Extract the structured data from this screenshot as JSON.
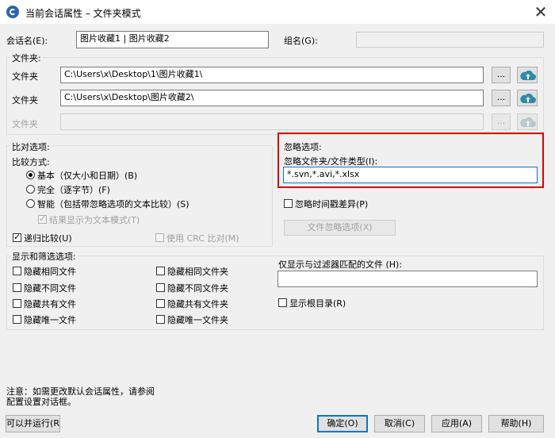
{
  "window": {
    "title": "当前会话属性 – 文件夹模式",
    "close_glyph": "✕"
  },
  "session": {
    "label": "会话名(E):",
    "value": "图片收藏1 | 图片收藏2",
    "group_label": "组名(G):",
    "group_value": ""
  },
  "folders": {
    "group_label": "文件夹:",
    "rows": [
      {
        "label": "文件夹",
        "path": "C:\\Users\\x\\Desktop\\1\\图片收藏1\\",
        "browse": "...",
        "enabled": true
      },
      {
        "label": "文件夹",
        "path": "C:\\Users\\x\\Desktop\\图片收藏2\\",
        "browse": "...",
        "enabled": true
      },
      {
        "label": "文件夹",
        "path": "",
        "browse": "...",
        "enabled": false
      }
    ]
  },
  "compare": {
    "group_label": "比对选项:",
    "method_label": "比较方式:",
    "options": [
      {
        "label": "基本（仅大小和日期）(B)",
        "selected": true
      },
      {
        "label": "完全（逐字节）(F)",
        "selected": false
      },
      {
        "label": "智能（包括带忽略选项的文本比较）(S)",
        "selected": false
      }
    ],
    "text_mode_label": "结果显示为文本模式(T)",
    "recursive_label": "递归比较(U)",
    "crc_label": "使用 CRC 比对(M)"
  },
  "ignore": {
    "group_label": "忽略选项:",
    "types_label": "忽略文件夹/文件类型(I):",
    "types_value": "*.svn,*.avi,*.xlsx",
    "time_diff_label": "忽略时间戳差异(P)",
    "ignore_opts_button": "文件忽略选项(X)"
  },
  "filters": {
    "group_label": "显示和筛选选项:",
    "left": [
      "隐藏相同文件",
      "隐藏不同文件",
      "隐藏共有文件",
      "隐藏唯一文件"
    ],
    "right": [
      "隐藏相同文件夹",
      "隐藏不同文件夹",
      "隐藏共有文件夹",
      "隐藏唯一文件夹"
    ],
    "match_label": "仅显示与过滤器匹配的文件 (H):",
    "match_value": "",
    "show_root_label": "显示根目录(R)"
  },
  "note": {
    "line1": "注意：如需更改默认会话属性，请参阅",
    "line2": "配置设置对话框。"
  },
  "buttons": {
    "run_parallel": "可以并运行(R",
    "ok": "确定(O)",
    "cancel": "取消(C)",
    "apply": "应用(A)",
    "help": "帮助(H)"
  },
  "colors": {
    "highlight": "#e00000",
    "cloud": "#2e8ba8",
    "default_border": "#0078d7"
  }
}
